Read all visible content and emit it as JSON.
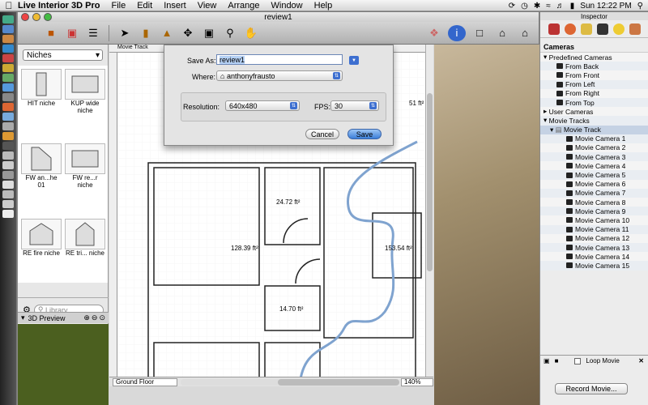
{
  "menubar": {
    "app_name": "Live Interior 3D Pro",
    "items": [
      "File",
      "Edit",
      "Insert",
      "View",
      "Arrange",
      "Window",
      "Help"
    ],
    "clock": "Sun 12:22 PM"
  },
  "window": {
    "title": "review1"
  },
  "library": {
    "category": "Niches",
    "items": [
      "HIT niche",
      "KUP wide niche",
      "FW an...he 01",
      "FW re...r niche",
      "RE fire niche",
      "RE tri... niche"
    ],
    "search_placeholder": "Library",
    "preview_label": "3D Preview"
  },
  "plan": {
    "tab_label": "Movie Track",
    "floor": "Ground Floor",
    "zoom": "140%",
    "areas": [
      "24.72 ft²",
      "128.39 ft²",
      "153.54 ft²",
      "14.70 ft²",
      "51 ft²"
    ]
  },
  "inspector": {
    "title": "Inspector",
    "section": "Cameras",
    "predefined_label": "Predefined Cameras",
    "predefined": [
      "From Back",
      "From Front",
      "From Left",
      "From Right",
      "From Top"
    ],
    "user_cameras": "User Cameras",
    "movie_tracks": "Movie Tracks",
    "movie_track": "Movie Track",
    "movie_cameras": [
      "Movie Camera 1",
      "Movie Camera 2",
      "Movie Camera 3",
      "Movie Camera 4",
      "Movie Camera 5",
      "Movie Camera 6",
      "Movie Camera 7",
      "Movie Camera 8",
      "Movie Camera 9",
      "Movie Camera 10",
      "Movie Camera 11",
      "Movie Camera 12",
      "Movie Camera 13",
      "Movie Camera 14",
      "Movie Camera 15"
    ],
    "loop_label": "Loop Movie",
    "record_label": "Record Movie..."
  },
  "save_dialog": {
    "save_as_label": "Save As:",
    "save_as_value": "review1",
    "where_label": "Where:",
    "where_value": "anthonyfrausto",
    "resolution_label": "Resolution:",
    "resolution_value": "640x480",
    "fps_label": "FPS:",
    "fps_value": "30",
    "cancel_label": "Cancel",
    "save_label": "Save"
  }
}
